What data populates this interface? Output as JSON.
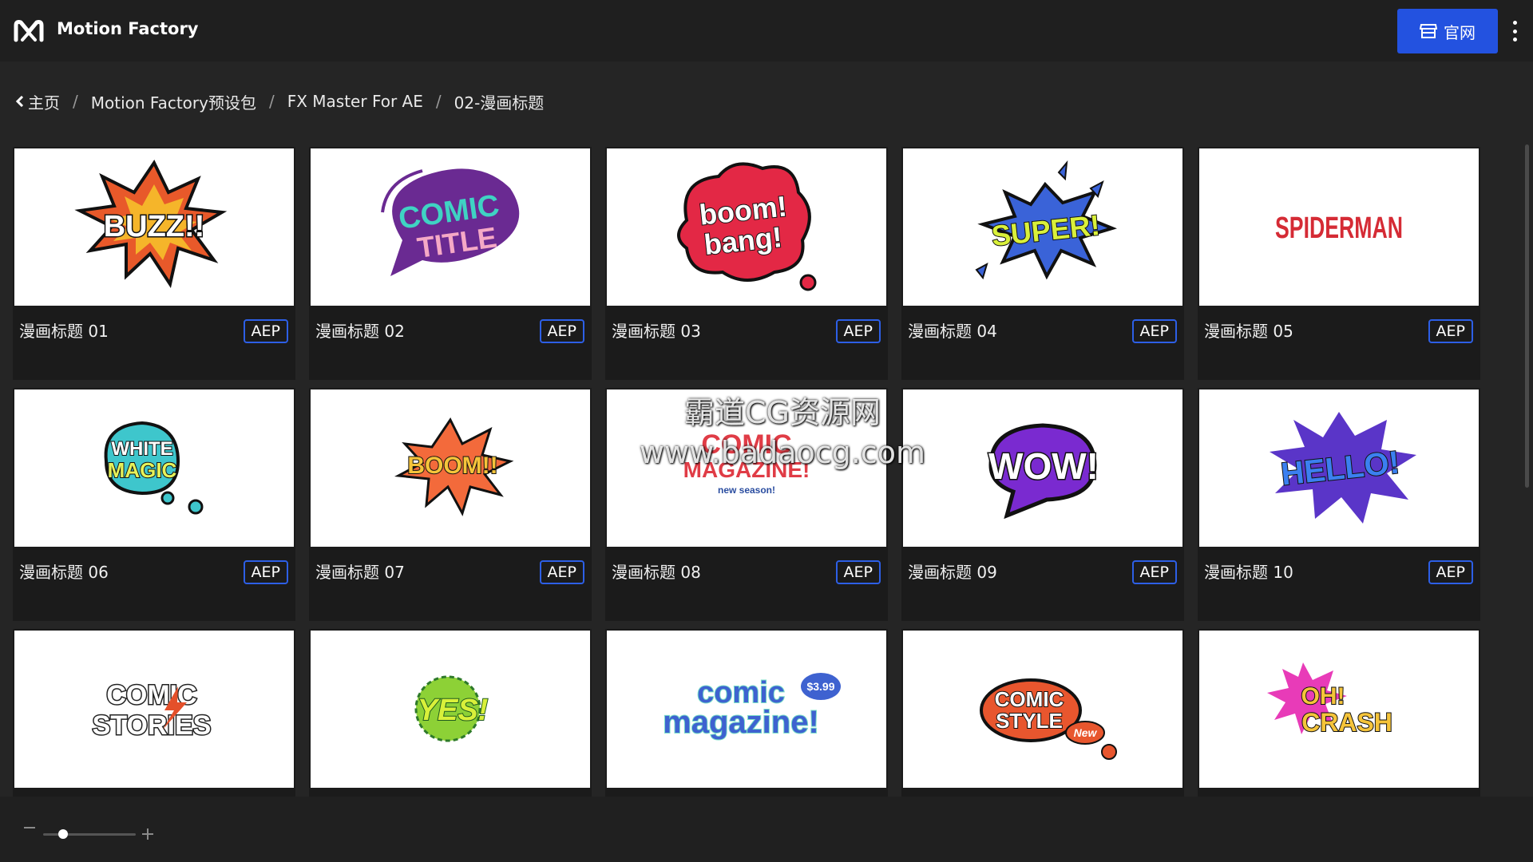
{
  "header": {
    "title": "Motion Factory",
    "site_button": "官网"
  },
  "breadcrumb": [
    "主页",
    "Motion Factory预设包",
    "FX Master For AE",
    "02-漫画标题"
  ],
  "cards": [
    {
      "title": "漫画标题 01",
      "badge": "AEP",
      "art": [
        "BUZZ!!"
      ]
    },
    {
      "title": "漫画标题 02",
      "badge": "AEP",
      "art": [
        "COMIC",
        "TITLE"
      ]
    },
    {
      "title": "漫画标题 03",
      "badge": "AEP",
      "art": [
        "boom!",
        "bang!"
      ]
    },
    {
      "title": "漫画标题 04",
      "badge": "AEP",
      "art": [
        "SUPER!"
      ]
    },
    {
      "title": "漫画标题 05",
      "badge": "AEP",
      "art": [
        "SPIDERMAN"
      ]
    },
    {
      "title": "漫画标题 06",
      "badge": "AEP",
      "art": [
        "WHITE",
        "MAGIC"
      ]
    },
    {
      "title": "漫画标题 07",
      "badge": "AEP",
      "art": [
        "BOOM!!"
      ]
    },
    {
      "title": "漫画标题 08",
      "badge": "AEP",
      "art": [
        "COMIC",
        "MAGAZINE!",
        "new season!"
      ]
    },
    {
      "title": "漫画标题 09",
      "badge": "AEP",
      "art": [
        "WOW!"
      ]
    },
    {
      "title": "漫画标题 10",
      "badge": "AEP",
      "art": [
        "HELLO!"
      ]
    },
    {
      "art": [
        "COMIC",
        "STORIES"
      ]
    },
    {
      "art": [
        "YES!"
      ]
    },
    {
      "art": [
        "comic",
        "magazine!",
        "$3.99"
      ]
    },
    {
      "art": [
        "COMIC",
        "STYLE",
        "New"
      ]
    },
    {
      "art": [
        "OH!",
        "CRASH"
      ]
    }
  ],
  "watermark": [
    "霸道CG资源网",
    "www.badaocg.com"
  ],
  "colors": {
    "accent": "#2352e0",
    "badge_border": "#2d5fe6",
    "topbar": "#1f1f1f",
    "background": "#252525"
  },
  "icons": {
    "logo": "motion-factory-logo",
    "site": "storefront-icon",
    "menu": "kebab-menu-icon",
    "back": "chevron-left-icon"
  }
}
